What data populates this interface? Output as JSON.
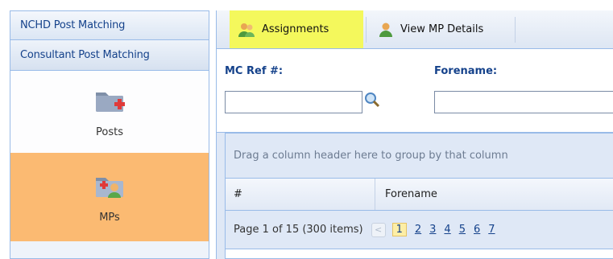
{
  "sidebar": {
    "headers": [
      "NCHD Post Matching",
      "Consultant Post Matching"
    ],
    "tiles": [
      {
        "label": "Posts",
        "icon": "folder-add-icon",
        "active": false
      },
      {
        "label": "MPs",
        "icon": "folder-user-icon",
        "active": true
      }
    ]
  },
  "toolbar": {
    "assignments_label": "Assignments",
    "view_mp_label": "View MP Details"
  },
  "filters": {
    "mc_ref_label": "MC Ref #:",
    "forename_label": "Forename:",
    "mc_ref_value": "",
    "forename_value": ""
  },
  "grid": {
    "group_hint": "Drag a column header here to group by that column",
    "columns": [
      "#",
      "Forename"
    ]
  },
  "pager": {
    "summary": "Page 1 of 15 (300 items)",
    "prev": "<",
    "pages": [
      "1",
      "2",
      "3",
      "4",
      "5",
      "6",
      "7"
    ],
    "current": "1"
  },
  "colors": {
    "highlight": "#f4f85c",
    "active_tile": "#fbba72",
    "border": "#99bbe8",
    "header_text": "#15428b"
  }
}
